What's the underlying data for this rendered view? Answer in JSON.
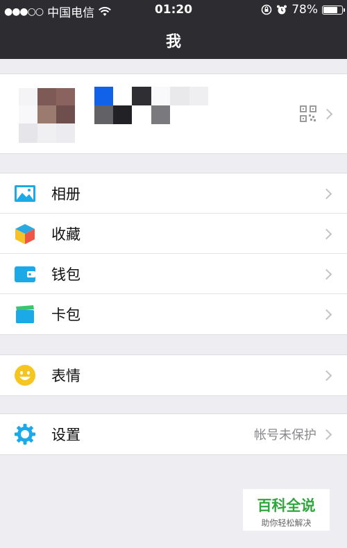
{
  "status_bar": {
    "signal": "●●●○○",
    "carrier": "中国电信",
    "time": "01:20",
    "battery_text": "78%",
    "battery_level": 0.78
  },
  "nav": {
    "title": "我"
  },
  "menu_groups": [
    {
      "items": [
        {
          "label": "相册",
          "icon": "photo-album-icon"
        },
        {
          "label": "收藏",
          "icon": "favorites-cube-icon"
        },
        {
          "label": "钱包",
          "icon": "wallet-icon"
        },
        {
          "label": "卡包",
          "icon": "card-pack-icon"
        }
      ]
    },
    {
      "items": [
        {
          "label": "表情",
          "icon": "sticker-smiley-icon"
        }
      ]
    },
    {
      "items": [
        {
          "label": "设置",
          "icon": "settings-gear-icon",
          "value": "帐号未保护"
        }
      ]
    }
  ],
  "watermark": {
    "title": "百科全说",
    "subtitle": "助你轻松解决"
  },
  "colors": {
    "bar": "#2d2d31",
    "accent_blue": "#1ba9e8",
    "wm_green": "#2fa73d"
  }
}
